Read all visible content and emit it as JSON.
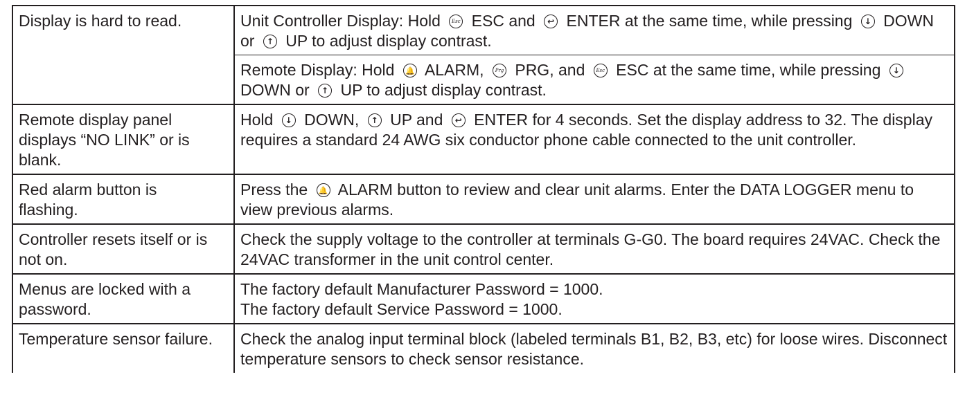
{
  "icons": {
    "esc": "Esc",
    "prg": "Prg",
    "enter": "↩",
    "down": "↓",
    "up": "↑",
    "alarm": "🔔"
  },
  "rows": [
    {
      "problem": "Display is hard to read.",
      "para1": {
        "a": "Unit Controller Display:  Hold",
        "b": "ESC and",
        "c": "ENTER at the same time, while pressing",
        "d": "DOWN or",
        "e": "UP to adjust display contrast."
      },
      "para2": {
        "a": "Remote Display:  Hold",
        "b": "ALARM,",
        "c": "PRG, and",
        "d": "ESC at the same time, while pressing",
        "e": "DOWN or",
        "f": "UP to adjust display contrast."
      }
    },
    {
      "problem": "Remote display panel displays “NO LINK” or is blank.",
      "a": "Hold",
      "b": "DOWN,",
      "c": "UP and",
      "d": "ENTER for 4 seconds. Set the display address to 32. The display requires a standard 24 AWG six conductor phone cable connected to the unit controller."
    },
    {
      "problem": "Red alarm button is flashing.",
      "a": "Press the",
      "b": "ALARM button to review and clear unit alarms. Enter the DATA LOGGER menu to view previous alarms."
    },
    {
      "problem": "Controller resets itself or is not on.",
      "solution": "Check the supply voltage to the controller at terminals G-G0. The board requires 24VAC. Check the 24VAC transformer in the unit control center."
    },
    {
      "problem": "Menus are locked with a password.",
      "line1": "The factory default Manufacturer Password = 1000.",
      "line2": "The factory default Service Password = 1000."
    },
    {
      "problem": "Temperature sensor failure.",
      "solution": "Check the analog input terminal block (labeled terminals B1, B2, B3, etc) for loose wires. Disconnect temperature sensors to check sensor resistance."
    }
  ]
}
